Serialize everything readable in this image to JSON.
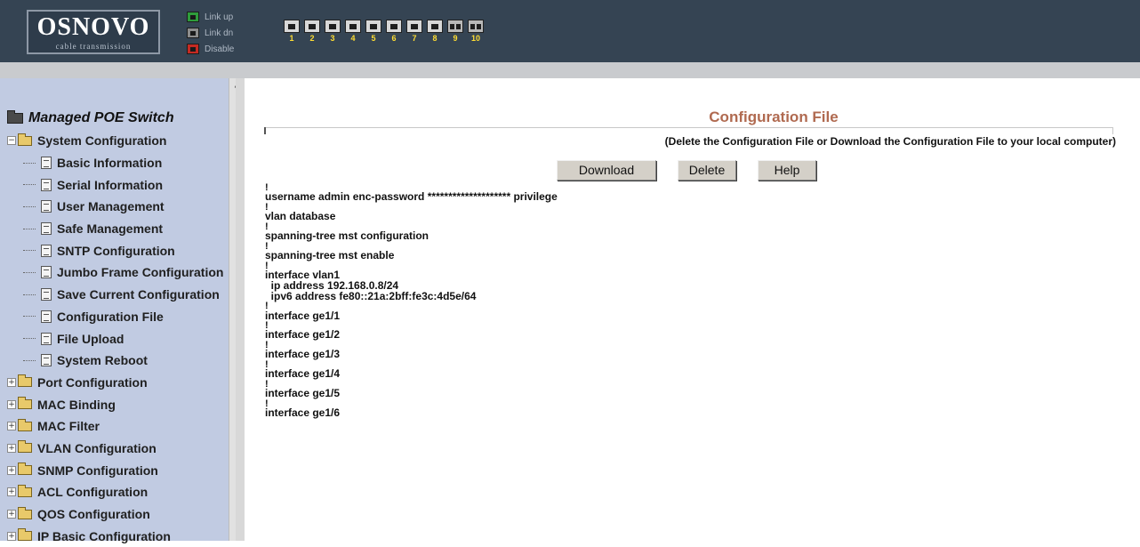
{
  "header": {
    "logo_main": "OSNOVO",
    "logo_sub": "cable transmission",
    "legend": [
      {
        "label": "Link up",
        "state": "up",
        "icon": "port-link-up-icon"
      },
      {
        "label": "Link dn",
        "state": "dn",
        "icon": "port-link-down-icon"
      },
      {
        "label": "Disable",
        "state": "dis",
        "icon": "port-disabled-icon"
      }
    ],
    "ports": [
      "1",
      "2",
      "3",
      "4",
      "5",
      "6",
      "7",
      "8",
      "9",
      "10"
    ],
    "colors": {
      "header_bg": "#354453",
      "port_number": "#ffdd33",
      "link_up": "#2e9d3b",
      "disable": "#c52a23"
    }
  },
  "sidebar": {
    "root_title": "Managed POE Switch",
    "items": [
      {
        "label": "System Configuration",
        "type": "folder-open",
        "level": 1
      },
      {
        "label": "Basic Information",
        "type": "page",
        "level": 2
      },
      {
        "label": "Serial Information",
        "type": "page",
        "level": 2
      },
      {
        "label": "User Management",
        "type": "page",
        "level": 2
      },
      {
        "label": "Safe Management",
        "type": "page",
        "level": 2
      },
      {
        "label": "SNTP Configuration",
        "type": "page",
        "level": 2
      },
      {
        "label": "Jumbo Frame Configuration",
        "type": "page",
        "level": 2
      },
      {
        "label": "Save Current Configuration",
        "type": "page",
        "level": 2
      },
      {
        "label": "Configuration File",
        "type": "page",
        "level": 2
      },
      {
        "label": "File Upload",
        "type": "page",
        "level": 2
      },
      {
        "label": "System Reboot",
        "type": "page",
        "level": 2
      },
      {
        "label": "Port Configuration",
        "type": "folder",
        "level": 1
      },
      {
        "label": "MAC Binding",
        "type": "folder",
        "level": 1
      },
      {
        "label": "MAC Filter",
        "type": "folder",
        "level": 1
      },
      {
        "label": "VLAN Configuration",
        "type": "folder",
        "level": 1
      },
      {
        "label": "SNMP Configuration",
        "type": "folder",
        "level": 1
      },
      {
        "label": "ACL Configuration",
        "type": "folder",
        "level": 1
      },
      {
        "label": "QOS Configuration",
        "type": "folder",
        "level": 1
      },
      {
        "label": "IP Basic Configuration",
        "type": "folder",
        "level": 1
      }
    ]
  },
  "main": {
    "title": "Configuration File",
    "subtitle": "(Delete the Configuration File or Download the Configuration File to your local computer)",
    "buttons": {
      "download": "Download",
      "delete": "Delete",
      "help": "Help"
    },
    "config_lines": [
      "!",
      "username admin enc-password ******************** privilege",
      "!",
      "vlan database",
      "!",
      "spanning-tree mst configuration",
      "!",
      "spanning-tree mst enable",
      "!",
      "interface vlan1",
      "  ip address 192.168.0.8/24",
      "  ipv6 address fe80::21a:2bff:fe3c:4d5e/64",
      "!",
      "interface ge1/1",
      "!",
      "interface ge1/2",
      "!",
      "interface ge1/3",
      "!",
      "interface ge1/4",
      "!",
      "interface ge1/5",
      "!",
      "interface ge1/6"
    ],
    "title_color": "#b06a50"
  }
}
